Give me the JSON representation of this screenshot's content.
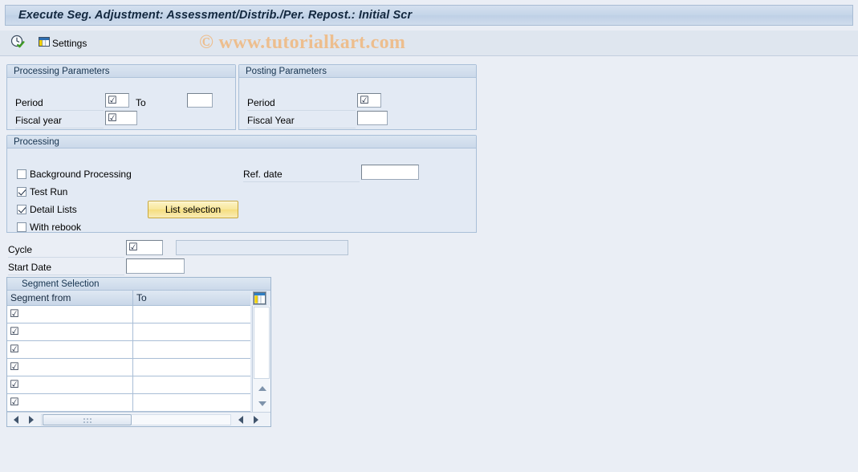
{
  "window": {
    "title": "Execute Seg. Adjustment: Assessment/Distrib./Per. Repost.: Initial Scr"
  },
  "watermark": {
    "text": "© www.tutorialkart.com",
    "color": "#edbe8e"
  },
  "toolbar": {
    "items": [
      {
        "icon": "execute-clock-check-icon",
        "label": ""
      },
      {
        "icon": "settings-table-icon",
        "label": "Settings"
      }
    ]
  },
  "processing_parameters": {
    "title": "Processing Parameters",
    "period_label": "Period",
    "period_value": "☑",
    "to_label": "To",
    "to_value": "",
    "fiscal_year_label": "Fiscal year",
    "fiscal_year_value": "☑"
  },
  "posting_parameters": {
    "title": "Posting Parameters",
    "period_label": "Period",
    "period_value": "☑",
    "fiscal_year_label": "Fiscal Year",
    "fiscal_year_value": ""
  },
  "processing": {
    "title": "Processing",
    "checkboxes": [
      {
        "label": "Background Processing",
        "checked": false
      },
      {
        "label": "Test Run",
        "checked": true
      },
      {
        "label": "Detail Lists",
        "checked": true
      },
      {
        "label": "With rebook",
        "checked": false
      }
    ],
    "ref_date_label": "Ref. date",
    "ref_date_value": "",
    "list_selection_button": "List selection"
  },
  "cycle_section": {
    "cycle_label": "Cycle",
    "cycle_value": "☑",
    "cycle_text_value": "",
    "start_date_label": "Start Date",
    "start_date_value": ""
  },
  "segment_selection": {
    "title": "Segment Selection",
    "columns": [
      "Segment from",
      "To"
    ],
    "config_icon": "table-settings-icon",
    "rows": [
      {
        "segment_from": "☑",
        "to": ""
      },
      {
        "segment_from": "☑",
        "to": ""
      },
      {
        "segment_from": "☑",
        "to": ""
      },
      {
        "segment_from": "☑",
        "to": ""
      },
      {
        "segment_from": "☑",
        "to": ""
      },
      {
        "segment_from": "☑",
        "to": ""
      }
    ]
  }
}
